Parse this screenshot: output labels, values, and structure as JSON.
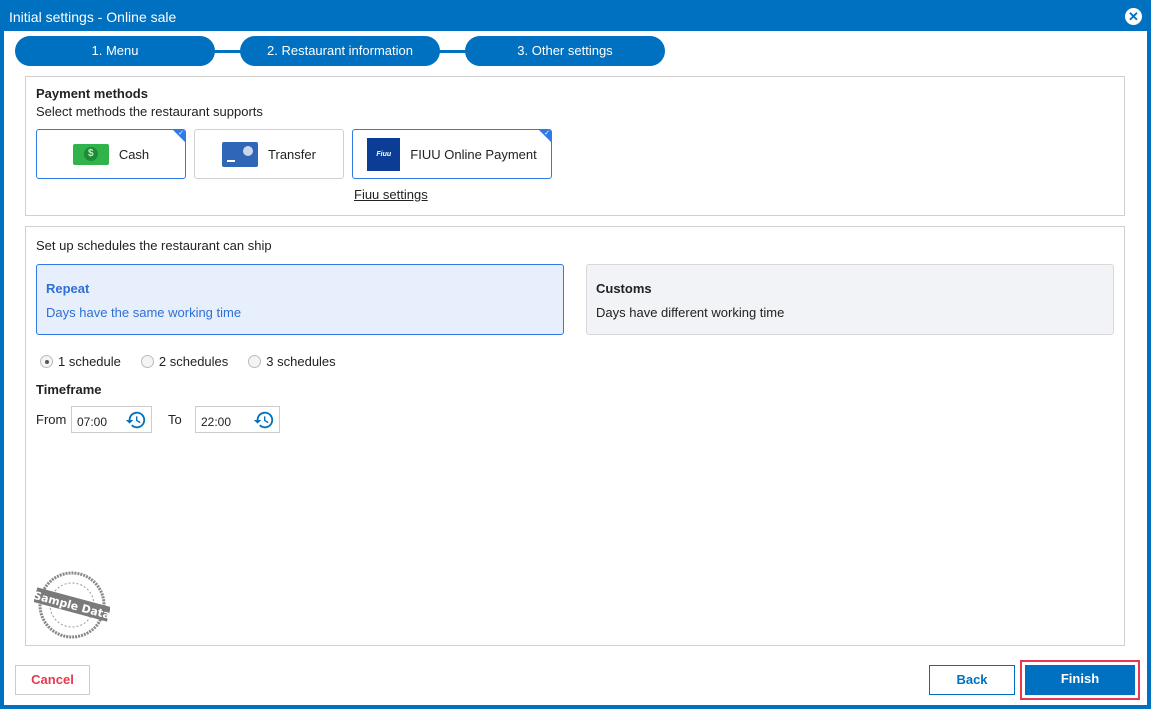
{
  "window": {
    "title": "Initial settings - Online sale"
  },
  "steps": [
    "1. Menu",
    "2. Restaurant information",
    "3. Other settings"
  ],
  "payment": {
    "title": "Payment methods",
    "subtitle": "Select methods the restaurant supports",
    "methods": [
      {
        "label": "Cash",
        "selected": true
      },
      {
        "label": "Transfer",
        "selected": false
      },
      {
        "label": "FIUU Online Payment",
        "selected": true,
        "logo_text": "Fiuu"
      }
    ],
    "link": "Fiuu settings"
  },
  "schedule": {
    "title": "Set up schedules the restaurant can ship",
    "modes": [
      {
        "title": "Repeat",
        "desc": "Days have the same working time",
        "selected": true
      },
      {
        "title": "Customs",
        "desc": "Days have different working time",
        "selected": false
      }
    ],
    "options": [
      {
        "label": "1 schedule",
        "selected": true
      },
      {
        "label": "2 schedules",
        "selected": false
      },
      {
        "label": "3 schedules",
        "selected": false
      }
    ],
    "timeframe": {
      "title": "Timeframe",
      "from_label": "From",
      "from": "07:00",
      "to_label": "To",
      "to": "22:00"
    }
  },
  "stamp": "Sample Data",
  "footer": {
    "cancel": "Cancel",
    "back": "Back",
    "finish": "Finish"
  },
  "colors": {
    "primary": "#0070c0",
    "cancel": "#e8384f",
    "highlight": "#e8384f"
  }
}
